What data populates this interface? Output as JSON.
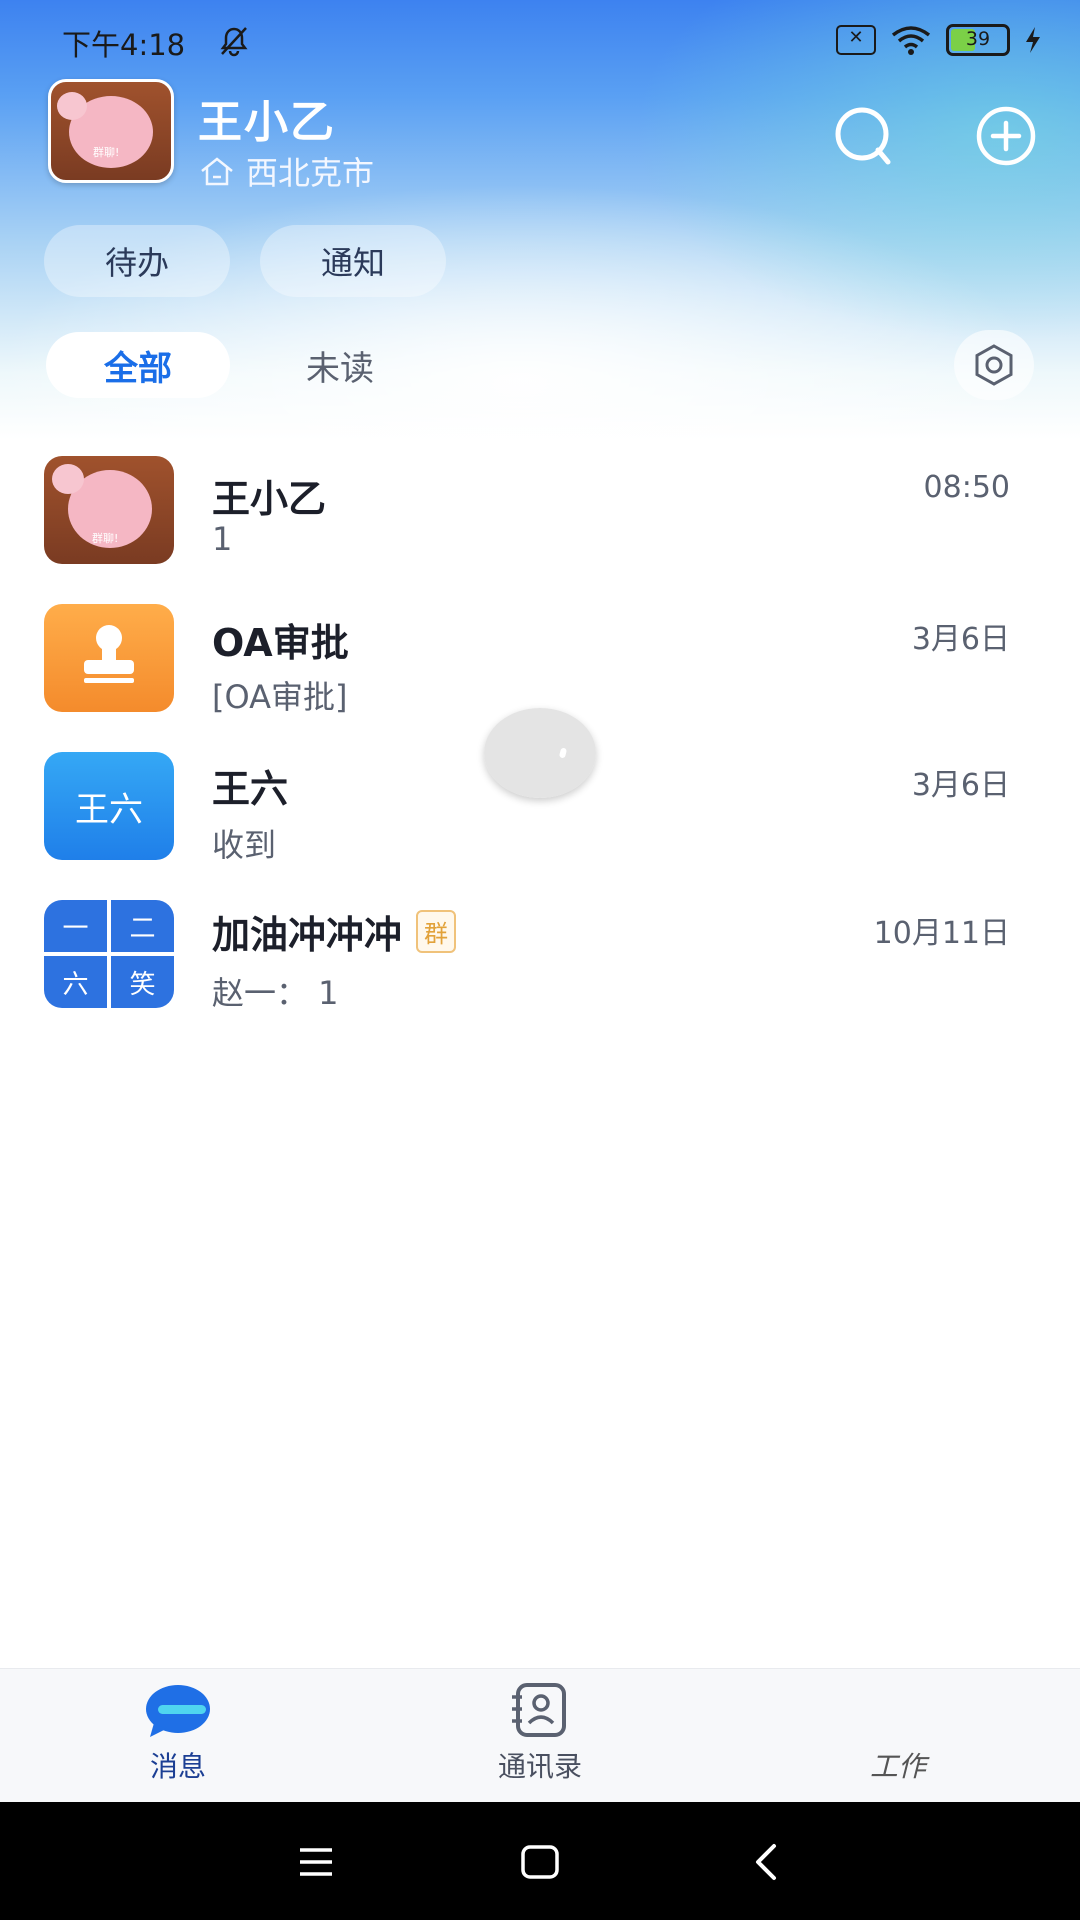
{
  "status_bar": {
    "time": "下午4:18",
    "battery": "39"
  },
  "profile": {
    "name": "王小乙",
    "location": "西北克市",
    "avatar_text": "群聊!"
  },
  "pills": {
    "todo": "待办",
    "notice": "通知"
  },
  "tabs": {
    "all": "全部",
    "unread": "未读"
  },
  "conversations": [
    {
      "title": "王小乙",
      "subtitle": "1",
      "time": "08:50",
      "avatar_text": "群聊!"
    },
    {
      "title": "OA审批",
      "subtitle": "[OA审批]",
      "time": "3月6日"
    },
    {
      "title": "王六",
      "subtitle": "收到",
      "time": "3月6日",
      "avatar_text": "王六"
    },
    {
      "title": "加油冲冲冲",
      "badge": "群",
      "subtitle": "赵一： 1",
      "time": "10月11日",
      "avatar_cells": [
        "一",
        "二",
        "六",
        "笑"
      ]
    }
  ],
  "bottom_nav": {
    "messages": "消息",
    "contacts": "通讯录",
    "work": "工作"
  },
  "colors": {
    "accent": "#1a6ee8",
    "header_top": "#3d82f0",
    "oa_orange": "#f48b2c",
    "group_badge": "#e2a23a"
  }
}
